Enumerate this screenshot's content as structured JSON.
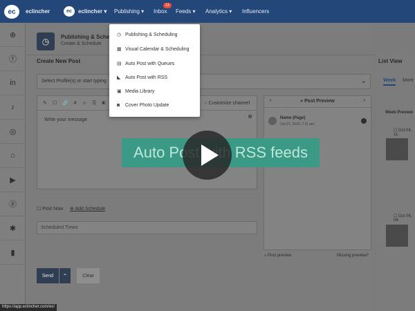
{
  "topbar": {
    "logo": "ec",
    "brand": "eclincher",
    "account_logo": "ec",
    "account": "eclincher",
    "nav": [
      "Publishing",
      "Inbox",
      "Feeds",
      "Analytics",
      "Influencers"
    ],
    "inbox_badge": "13"
  },
  "rail_icons": [
    "add-user-icon",
    "facebook-icon",
    "linkedin-icon",
    "twitter-icon",
    "instagram-icon",
    "store-icon",
    "youtube-icon",
    "pinterest-icon",
    "yelp-icon",
    "analytics-icon"
  ],
  "header": {
    "title": "Publishing & Scheduling",
    "subtitle": "Create & Schedule"
  },
  "composer": {
    "section_title": "Create New Post",
    "profile_placeholder": "Select Profile(s) or start typing",
    "tools": "✎ ☐ 🔗 # ☺ ⎘ ▣ ✂ ✐",
    "customize": "Customize channel",
    "message_placeholder": "Write your message",
    "post_now": "Post Now",
    "add_schedule": "Add Schedule",
    "scheduled_times": "Scheduled Times",
    "send": "Send",
    "clear": "Clear"
  },
  "preview": {
    "title": "Post Preview",
    "name": "Name (Page)",
    "date": "Oct 07, 2020, 7:11 am",
    "post_preview_link": "Post preview",
    "missing_link": "Missing preview?"
  },
  "listview": {
    "title": "List View",
    "tab_week": "Week",
    "tab_month": "Mont",
    "week_preview": "Week Preview",
    "day1": "Oct 04, 11:",
    "day2": "Oct 06, 08"
  },
  "menu": {
    "items": [
      {
        "label": "Publishing & Scheduling",
        "icon": "◷"
      },
      {
        "label": "Visual Calendar & Scheduling",
        "icon": "▦"
      },
      {
        "label": "Auto Post with Queues",
        "icon": "▤"
      },
      {
        "label": "Auto Post with RSS",
        "icon": "◣"
      },
      {
        "label": "Media Library",
        "icon": "▣"
      },
      {
        "label": "Cover Photo Update",
        "icon": "◙"
      }
    ]
  },
  "video": {
    "banner": "Auto Post with RSS feeds"
  },
  "status_url": "https://app.eclincher.com/ec/"
}
